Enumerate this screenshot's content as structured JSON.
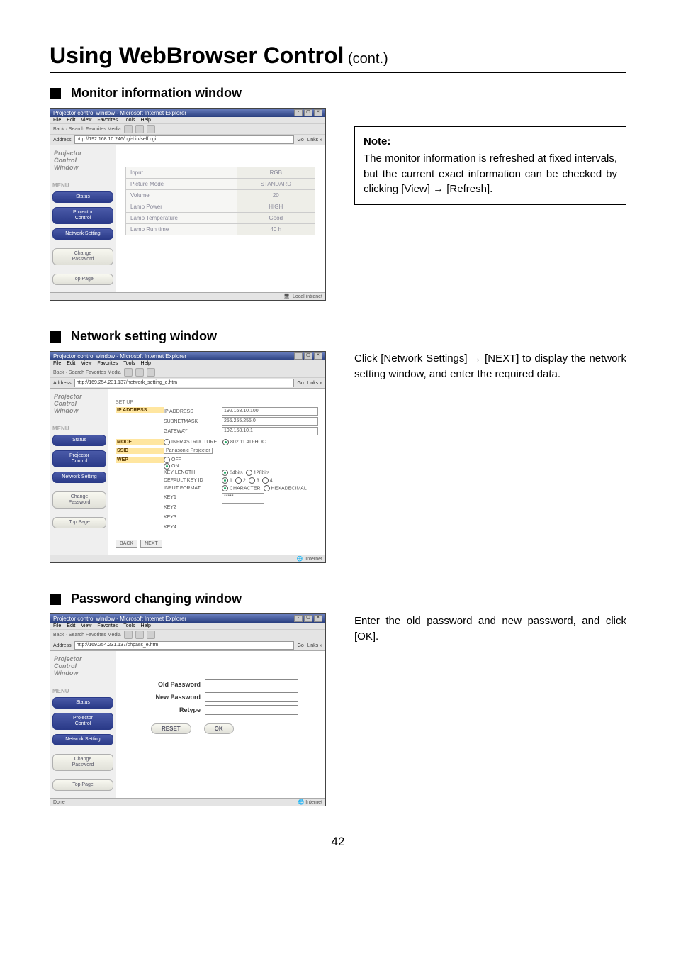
{
  "page": {
    "title_main": "Using WebBrowser Control",
    "title_suffix": " (cont.)",
    "number": "42"
  },
  "section1": {
    "heading": "Monitor information window",
    "browser": {
      "title": "Projector control window - Microsoft Internet Explorer",
      "menubar": [
        "File",
        "Edit",
        "View",
        "Favorites",
        "Tools",
        "Help"
      ],
      "toolbar_hint": "Back  ·  Search  Favorites  Media",
      "address_label": "Address",
      "address_value": "http://192.168.10.246/cgi-bin/self.cgi",
      "go_label": "Go",
      "links_label": "Links »",
      "logo": "Projector\nControl\nWindow",
      "menu_label": "MENU",
      "sidebar": [
        {
          "label": "Status",
          "style": "indigo"
        },
        {
          "label": "Projector\nControl",
          "style": "indigo"
        },
        {
          "label": "Network Setting",
          "style": "indigo"
        },
        {
          "label": "Change\nPassword",
          "style": "plain"
        },
        {
          "label": "Top Page",
          "style": "plain"
        }
      ],
      "status_rows": [
        {
          "k": "Input",
          "v": "RGB"
        },
        {
          "k": "Picture Mode",
          "v": "STANDARD"
        },
        {
          "k": "Volume",
          "v": "20"
        },
        {
          "k": "Lamp Power",
          "v": "HIGH"
        },
        {
          "k": "Lamp Temperature",
          "v": "Good"
        },
        {
          "k": "Lamp Run time",
          "v": "40 h"
        }
      ],
      "status_text": "Local intranet"
    },
    "note": {
      "head": "Note:",
      "body": "The monitor information is refreshed at fixed intervals, but the current exact information can be checked by clicking [View] → [Refresh]."
    }
  },
  "section2": {
    "heading": "Network setting window",
    "desc": "Click [Network Settings] → [NEXT] to display the network setting window, and enter the required data.",
    "browser": {
      "title": "Projector control window - Microsoft Internet Explorer",
      "menubar": [
        "File",
        "Edit",
        "View",
        "Favorites",
        "Tools",
        "Help"
      ],
      "toolbar_hint": "Back  ·  Search  Favorites  Media",
      "address_label": "Address",
      "address_value": "http://169.254.231.137/network_setting_e.htm",
      "go_label": "Go",
      "links_label": "Links »",
      "logo": "Projector\nControl\nWindow",
      "menu_label": "MENU",
      "sidebar": [
        {
          "label": "Status",
          "style": "indigo"
        },
        {
          "label": "Projector\nControl",
          "style": "indigo"
        },
        {
          "label": "Network Setting",
          "style": "indigo"
        },
        {
          "label": "Change\nPassword",
          "style": "plain"
        },
        {
          "label": "Top Page",
          "style": "plain"
        }
      ],
      "setup_label": "SET UP",
      "ip_label": "IP ADDRESS",
      "ip_rows": [
        {
          "k": "IP ADDRESS",
          "v": "192.168.10.100"
        },
        {
          "k": "SUBNETMASK",
          "v": "255.255.255.0"
        },
        {
          "k": "GATEWAY",
          "v": "192.168.10.1"
        }
      ],
      "mode_label": "MODE",
      "mode_opt1": "INFRASTRUCTURE",
      "mode_opt2": "802.11 AD-HOC",
      "ssid_label": "SSID",
      "ssid_value": "Panasonic Projector",
      "wep_label": "WEP",
      "wep_off": "OFF",
      "wep_on": "ON",
      "keylength_label": "KEY LENGTH",
      "keylength_opts": [
        "64bits",
        "128bits"
      ],
      "defaultkeyid_label": "DEFAULT KEY ID",
      "defaultkeyid_opts": [
        "1",
        "2",
        "3",
        "4"
      ],
      "inputformat_label": "INPUT FORMAT",
      "inputformat_opts": [
        "CHARACTER",
        "HEXADECIMAL"
      ],
      "keys": [
        "KEY1",
        "KEY2",
        "KEY3",
        "KEY4"
      ],
      "key1_value": "*****",
      "back_label": "BACK",
      "next_label": "NEXT",
      "status_text": "Internet"
    }
  },
  "section3": {
    "heading": "Password changing window",
    "desc": "Enter the old password and new password, and click [OK].",
    "browser": {
      "title": "Projector control window - Microsoft Internet Explorer",
      "menubar": [
        "File",
        "Edit",
        "View",
        "Favorites",
        "Tools",
        "Help"
      ],
      "toolbar_hint": "Back  ·  Search  Favorites  Media",
      "address_label": "Address",
      "address_value": "http://169.254.231.137/chpass_e.htm",
      "go_label": "Go",
      "links_label": "Links »",
      "logo": "Projector\nControl\nWindow",
      "menu_label": "MENU",
      "sidebar": [
        {
          "label": "Status",
          "style": "indigo"
        },
        {
          "label": "Projector\nControl",
          "style": "indigo"
        },
        {
          "label": "Network Setting",
          "style": "indigo"
        },
        {
          "label": "Change\nPassword",
          "style": "plain"
        },
        {
          "label": "Top Page",
          "style": "plain"
        }
      ],
      "old_pw_label": "Old Password",
      "new_pw_label": "New Password",
      "retype_label": "Retype",
      "reset_label": "RESET",
      "ok_label": "OK",
      "status_left": "Done",
      "status_text": "Internet"
    }
  }
}
